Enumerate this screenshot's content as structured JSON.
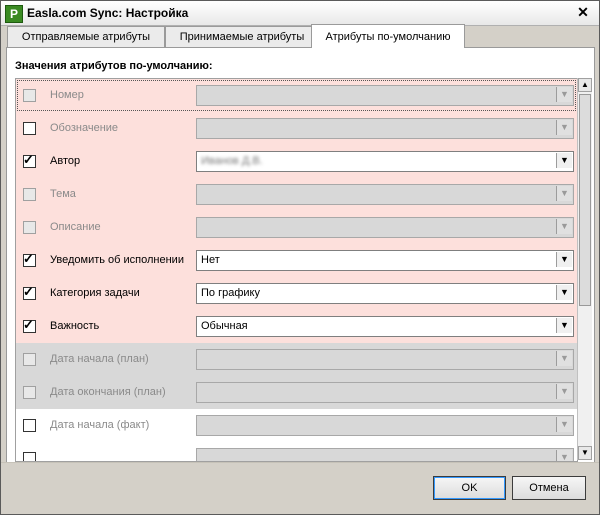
{
  "window": {
    "title": "Easla.com Sync: Настройка",
    "icon_letter": "P",
    "close_glyph": "✕"
  },
  "tabs": [
    {
      "label": "Отправляемые атрибуты",
      "active": false
    },
    {
      "label": "Принимаемые атрибуты",
      "active": false
    },
    {
      "label": "Атрибуты по-умолчанию",
      "active": true
    }
  ],
  "section": {
    "label": "Значения атрибутов по-умолчанию:"
  },
  "rows": [
    {
      "label": "Номер",
      "checked": false,
      "enabled": false,
      "value": "",
      "bg": "pink"
    },
    {
      "label": "Обозначение",
      "checked": false,
      "enabled": false,
      "value": "",
      "bg": "pink"
    },
    {
      "label": "Автор",
      "checked": true,
      "enabled": true,
      "value": "Иванов Д.В.",
      "blurred": true,
      "bg": "pink"
    },
    {
      "label": "Тема",
      "checked": false,
      "enabled": false,
      "value": "",
      "bg": "pink"
    },
    {
      "label": "Описание",
      "checked": false,
      "enabled": false,
      "value": "",
      "bg": "pink"
    },
    {
      "label": "Уведомить об исполнении",
      "checked": true,
      "enabled": true,
      "value": "Нет",
      "bg": "pink"
    },
    {
      "label": "Категория задачи",
      "checked": true,
      "enabled": true,
      "value": "По графику",
      "bg": "pink"
    },
    {
      "label": "Важность",
      "checked": true,
      "enabled": true,
      "value": "Обычная",
      "bg": "pink"
    },
    {
      "label": "Дата начала (план)",
      "checked": false,
      "enabled": false,
      "value": "",
      "bg": "gray"
    },
    {
      "label": "Дата окончания (план)",
      "checked": false,
      "enabled": false,
      "value": "",
      "bg": "gray"
    },
    {
      "label": "Дата начала (факт)",
      "checked": false,
      "enabled": false,
      "value": "",
      "bg": "white"
    },
    {
      "label": "",
      "checked": false,
      "enabled": false,
      "value": "",
      "bg": "white"
    }
  ],
  "buttons": {
    "ok": "OK",
    "cancel": "Отмена"
  },
  "colors": {
    "row_highlight": "#fde0dc",
    "row_disabled": "#d8d8d8",
    "accent_focus": "#3399ff"
  },
  "icons": {
    "checkmark": "✓",
    "dropdown": "▼",
    "scroll_up": "▲",
    "scroll_down": "▼"
  }
}
